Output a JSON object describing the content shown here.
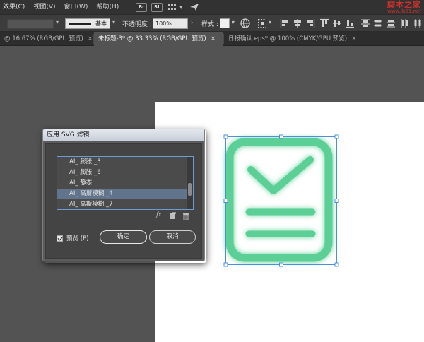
{
  "menu": {
    "items": [
      "效果(C)",
      "视图(V)",
      "窗口(W)",
      "帮助(H)"
    ],
    "app_buttons": [
      "Br",
      "St"
    ]
  },
  "watermark": {
    "title": "脚本之家",
    "url": "www.jb51.net"
  },
  "control_bar": {
    "stroke_style_label": "基本",
    "opacity_label": "不透明度 :",
    "opacity_value": "100%",
    "style_label": "样式 :"
  },
  "tabs": [
    {
      "label": "@ 16.67% (RGB/GPU 预览)",
      "active": false
    },
    {
      "label": "未标题-3* @ 33.33% (RGB/GPU 预览)",
      "active": true
    },
    {
      "label": "日报确认.eps* @ 100% (CMYK/GPU 预览)",
      "active": false
    }
  ],
  "dialog": {
    "title": "应用 SVG 滤镜",
    "filters": [
      {
        "label": "AI_ 膨胀 _3",
        "selected": false
      },
      {
        "label": "AI_ 膨胀 _6",
        "selected": false
      },
      {
        "label": "AI_ 静态",
        "selected": false
      },
      {
        "label": "AI_ 高斯模糊 _4",
        "selected": true
      },
      {
        "label": "AI_ 高斯模糊 _7",
        "selected": false
      }
    ],
    "fx_label": "fx",
    "preview_label": "预览 (P)",
    "preview_checked": true,
    "ok_label": "确定",
    "cancel_label": "取消"
  },
  "colors": {
    "icon_green": "#5ccf96",
    "glow_green": "#8de0b8",
    "selection_blue": "#4a8fe0",
    "selected_row": "#61748c"
  }
}
